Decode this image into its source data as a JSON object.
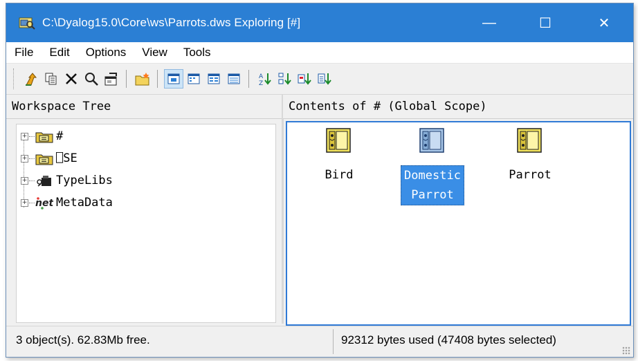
{
  "window": {
    "title": "C:\\Dyalog15.0\\Core\\ws\\Parrots.dws Exploring [#]",
    "minimize_label": "—",
    "maximize_label": "☐",
    "close_label": "✕"
  },
  "menu": [
    "File",
    "Edit",
    "Options",
    "View",
    "Tools"
  ],
  "toolbar": {
    "groups": [
      [
        "up-one-level-icon",
        "copy-icon",
        "delete-icon",
        "find-icon",
        "properties-icon"
      ],
      [
        "new-namespace-icon"
      ],
      [
        "large-icons-view-icon",
        "small-icons-view-icon",
        "list-view-icon",
        "details-view-icon"
      ],
      [
        "sort-by-name-icon",
        "sort-by-type-icon",
        "sort-by-size-icon",
        "sort-by-date-icon"
      ]
    ],
    "active": "large-icons-view-icon"
  },
  "tree": {
    "header": "Workspace Tree",
    "items": [
      {
        "label": "#",
        "icon": "namespace-icon"
      },
      {
        "label": "⎕SE",
        "icon": "namespace-icon"
      },
      {
        "label": "TypeLibs",
        "icon": "typelibs-icon"
      },
      {
        "label": "MetaData",
        "icon": "net-metadata-icon"
      }
    ]
  },
  "contents": {
    "header": "Contents of # (Global Scope)",
    "items": [
      {
        "label": "Bird",
        "icon": "class-icon",
        "selected": false
      },
      {
        "label": "Domestic\nParrot",
        "icon": "class-icon",
        "selected": true
      },
      {
        "label": "Parrot",
        "icon": "class-icon",
        "selected": false
      }
    ]
  },
  "status": {
    "left": "3 object(s). 62.83Mb free.",
    "right": "92312 bytes used (47408 bytes selected)"
  },
  "colors": {
    "titlebar": "#2b7fd4",
    "selection": "#3a8ee6",
    "folder_yellow": "#f2e35c"
  }
}
